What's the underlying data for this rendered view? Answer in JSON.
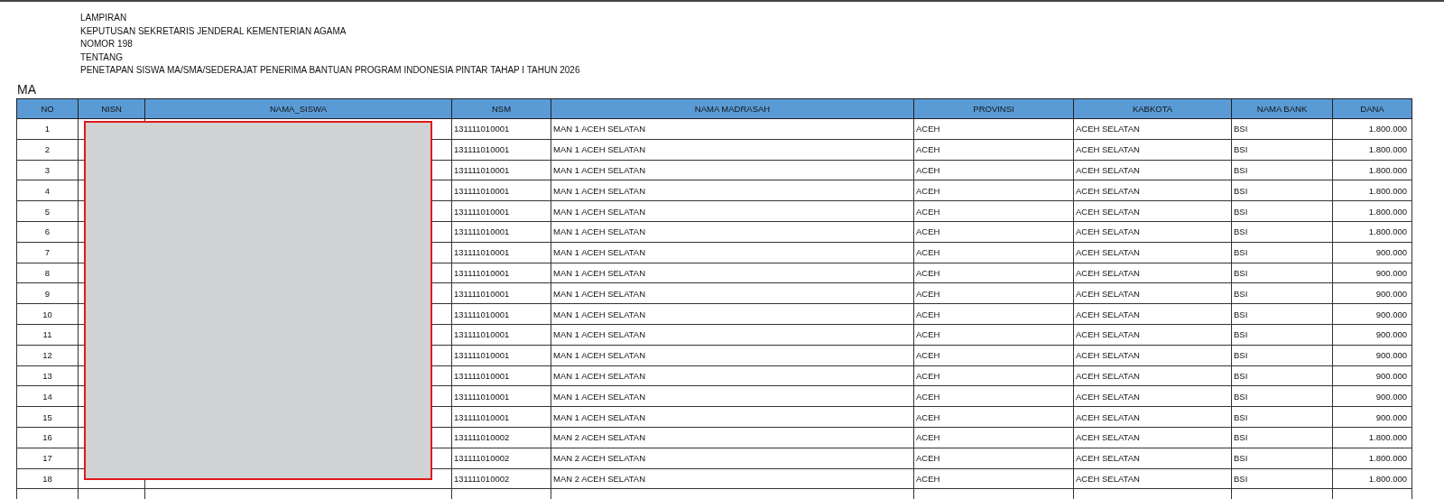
{
  "heading_lines": [
    "LAMPIRAN",
    "KEPUTUSAN SEKRETARIS JENDERAL KEMENTERIAN AGAMA",
    "NOMOR 198",
    "TENTANG",
    "PENETAPAN SISWA MA/SMA/SEDERAJAT PENERIMA BANTUAN PROGRAM INDONESIA PINTAR TAHAP I TAHUN 2026"
  ],
  "section_title": "MA",
  "table": {
    "columns": [
      "NO",
      "NISN",
      "NAMA_SISWA",
      "NSM",
      "NAMA MADRASAH",
      "PROVINSI",
      "KABKOTA",
      "NAMA BANK",
      "DANA"
    ],
    "rows": [
      {
        "no": "1",
        "nsm": "131111010001",
        "madrasah": "MAN 1 ACEH SELATAN",
        "provinsi": "ACEH",
        "kabkota": "ACEH SELATAN",
        "bank": "BSI",
        "dana": "1.800.000"
      },
      {
        "no": "2",
        "nsm": "131111010001",
        "madrasah": "MAN 1 ACEH SELATAN",
        "provinsi": "ACEH",
        "kabkota": "ACEH SELATAN",
        "bank": "BSI",
        "dana": "1.800.000"
      },
      {
        "no": "3",
        "nsm": "131111010001",
        "madrasah": "MAN 1 ACEH SELATAN",
        "provinsi": "ACEH",
        "kabkota": "ACEH SELATAN",
        "bank": "BSI",
        "dana": "1.800.000"
      },
      {
        "no": "4",
        "nsm": "131111010001",
        "madrasah": "MAN 1 ACEH SELATAN",
        "provinsi": "ACEH",
        "kabkota": "ACEH SELATAN",
        "bank": "BSI",
        "dana": "1.800.000"
      },
      {
        "no": "5",
        "nsm": "131111010001",
        "madrasah": "MAN 1 ACEH SELATAN",
        "provinsi": "ACEH",
        "kabkota": "ACEH SELATAN",
        "bank": "BSI",
        "dana": "1.800.000"
      },
      {
        "no": "6",
        "nsm": "131111010001",
        "madrasah": "MAN 1 ACEH SELATAN",
        "provinsi": "ACEH",
        "kabkota": "ACEH SELATAN",
        "bank": "BSI",
        "dana": "1.800.000"
      },
      {
        "no": "7",
        "nsm": "131111010001",
        "madrasah": "MAN 1 ACEH SELATAN",
        "provinsi": "ACEH",
        "kabkota": "ACEH SELATAN",
        "bank": "BSI",
        "dana": "900.000"
      },
      {
        "no": "8",
        "nsm": "131111010001",
        "madrasah": "MAN 1 ACEH SELATAN",
        "provinsi": "ACEH",
        "kabkota": "ACEH SELATAN",
        "bank": "BSI",
        "dana": "900.000"
      },
      {
        "no": "9",
        "nsm": "131111010001",
        "madrasah": "MAN 1 ACEH SELATAN",
        "provinsi": "ACEH",
        "kabkota": "ACEH SELATAN",
        "bank": "BSI",
        "dana": "900.000"
      },
      {
        "no": "10",
        "nsm": "131111010001",
        "madrasah": "MAN 1 ACEH SELATAN",
        "provinsi": "ACEH",
        "kabkota": "ACEH SELATAN",
        "bank": "BSI",
        "dana": "900.000"
      },
      {
        "no": "11",
        "nsm": "131111010001",
        "madrasah": "MAN 1 ACEH SELATAN",
        "provinsi": "ACEH",
        "kabkota": "ACEH SELATAN",
        "bank": "BSI",
        "dana": "900.000"
      },
      {
        "no": "12",
        "nsm": "131111010001",
        "madrasah": "MAN 1 ACEH SELATAN",
        "provinsi": "ACEH",
        "kabkota": "ACEH SELATAN",
        "bank": "BSI",
        "dana": "900.000"
      },
      {
        "no": "13",
        "nsm": "131111010001",
        "madrasah": "MAN 1 ACEH SELATAN",
        "provinsi": "ACEH",
        "kabkota": "ACEH SELATAN",
        "bank": "BSI",
        "dana": "900.000"
      },
      {
        "no": "14",
        "nsm": "131111010001",
        "madrasah": "MAN 1 ACEH SELATAN",
        "provinsi": "ACEH",
        "kabkota": "ACEH SELATAN",
        "bank": "BSI",
        "dana": "900.000"
      },
      {
        "no": "15",
        "nsm": "131111010001",
        "madrasah": "MAN 1 ACEH SELATAN",
        "provinsi": "ACEH",
        "kabkota": "ACEH SELATAN",
        "bank": "BSI",
        "dana": "900.000"
      },
      {
        "no": "16",
        "nsm": "131111010002",
        "madrasah": "MAN 2 ACEH SELATAN",
        "provinsi": "ACEH",
        "kabkota": "ACEH SELATAN",
        "bank": "BSI",
        "dana": "1.800.000"
      },
      {
        "no": "17",
        "nsm": "131111010002",
        "madrasah": "MAN 2 ACEH SELATAN",
        "provinsi": "ACEH",
        "kabkota": "ACEH SELATAN",
        "bank": "BSI",
        "dana": "1.800.000"
      },
      {
        "no": "18",
        "nsm": "131111010002",
        "madrasah": "MAN 2 ACEH SELATAN",
        "provinsi": "ACEH",
        "kabkota": "ACEH SELATAN",
        "bank": "BSI",
        "dana": "1.800.000"
      }
    ]
  }
}
